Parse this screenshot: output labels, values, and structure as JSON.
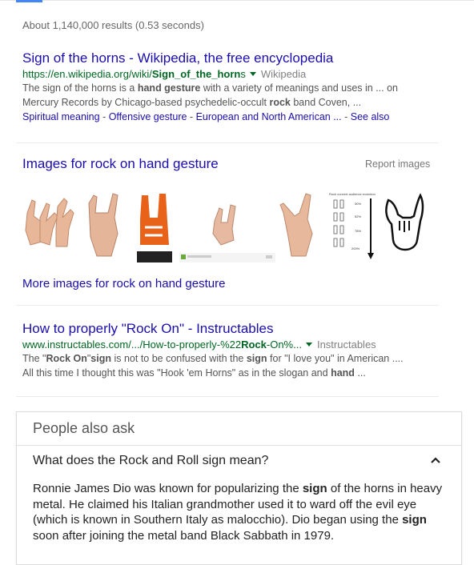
{
  "results_stats": "About 1,140,000 results (0.53 seconds)",
  "result1": {
    "title": "Sign of the horns - Wikipedia, the free encyclopedia",
    "url_pre": "https://en.wikipedia.org/wiki/",
    "url_bold": "Sign_of_the_horn",
    "url_post": "s",
    "source": "Wikipedia",
    "snip1_a": "The sign of the horns is a ",
    "snip1_b": "hand gesture",
    "snip1_c": " with a variety of meanings and uses in ... on",
    "snip2_a": "Mercury Records by Chicago-based psychedelic-occult ",
    "snip2_b": "rock",
    "snip2_c": " band Coven, ...",
    "sitelinks": [
      "Spiritual meaning",
      "Offensive gesture",
      "European and North American ...",
      "See also"
    ]
  },
  "images": {
    "heading": "Images for rock on hand gesture",
    "report": "Report images",
    "more": "More images for rock on hand gesture",
    "chart_caption": "Rock concert audience evolution",
    "chart_pcts": [
      "30%",
      "52%",
      "78%",
      "200%"
    ]
  },
  "result2": {
    "title": "How to properly \"Rock On\" - Instructables",
    "url_pre": "www.instructables.com/.../How-to-properly-%22",
    "url_bold": "Rock",
    "url_post": "-On%...",
    "source": "Instructables",
    "snip1_a": "The \"",
    "snip1_b": "Rock On",
    "snip1_c": "\"",
    "snip1_d": "sign",
    "snip1_e": " is not to be confused with the ",
    "snip1_f": "sign",
    "snip1_g": " for \"I love you\" in American ....",
    "snip2_a": "All this time I thought this was \"Hook 'em Horns\" as in the slogan and ",
    "snip2_b": "hand",
    "snip2_c": " ..."
  },
  "paa": {
    "heading": "People also ask",
    "question": "What does the Rock and Roll sign mean?",
    "ans_a": "Ronnie James Dio was known for popularizing the ",
    "ans_b": "sign",
    "ans_c": " of the horns in heavy metal. He claimed his Italian grandmother used it to ward off the evil eye (which is known in Southern Italy as malocchio). Dio began using the ",
    "ans_d": "sign",
    "ans_e": " soon after joining the metal band Black Sabbath in 1979."
  },
  "colors": {
    "link": "#1a0dab",
    "url": "#006621",
    "snippet": "#545454",
    "accent": "#4285f4",
    "foam_hand": "#e8621a"
  }
}
